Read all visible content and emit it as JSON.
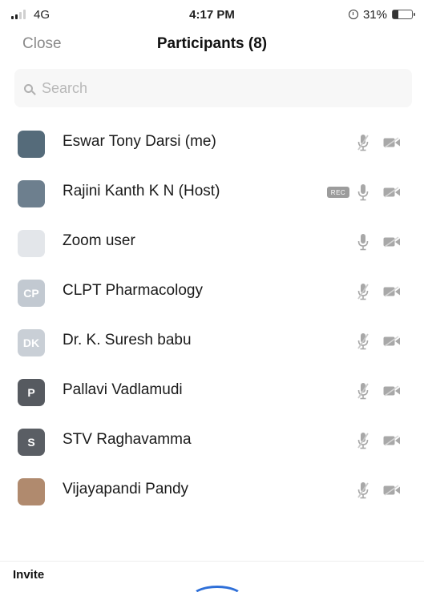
{
  "status_bar": {
    "carrier": "4G",
    "time": "4:17 PM",
    "battery": "31%",
    "battery_level": 0.31
  },
  "nav": {
    "close_label": "Close",
    "title": "Participants (8)"
  },
  "search": {
    "placeholder": "Search"
  },
  "participants": [
    {
      "name": "Eswar Tony Darsi (me)",
      "avatar_color": "#556b7a",
      "avatar_initials": "",
      "mic": "muted",
      "video": "off"
    },
    {
      "name": "Rajini Kanth K N (Host)",
      "avatar_color": "#6d7f8e",
      "avatar_initials": "",
      "mic": "on",
      "video": "off",
      "badge": "REC"
    },
    {
      "name": "Zoom user",
      "avatar_color": "#e3e6ea",
      "avatar_initials": "",
      "mic": "on",
      "video": "off"
    },
    {
      "name": "CLPT Pharmacology",
      "avatar_color": "#c2c9d1",
      "avatar_initials": "CP",
      "mic": "muted",
      "video": "off"
    },
    {
      "name": "Dr. K. Suresh babu",
      "avatar_color": "#c9cfd6",
      "avatar_initials": "DK",
      "mic": "muted",
      "video": "off"
    },
    {
      "name": "Pallavi Vadlamudi",
      "avatar_color": "#565a60",
      "avatar_initials": "P",
      "mic": "muted",
      "video": "off"
    },
    {
      "name": "STV Raghavamma",
      "avatar_color": "#5a5e64",
      "avatar_initials": "S",
      "mic": "muted",
      "video": "off"
    },
    {
      "name": "Vijayapandi Pandy",
      "avatar_color": "#b08a6e",
      "avatar_initials": "",
      "mic": "muted",
      "video": "off"
    }
  ],
  "footer": {
    "invite_label": "Invite"
  },
  "colors": {
    "accent": "#2e6fd8",
    "icon_gray": "#a8a8a8"
  }
}
